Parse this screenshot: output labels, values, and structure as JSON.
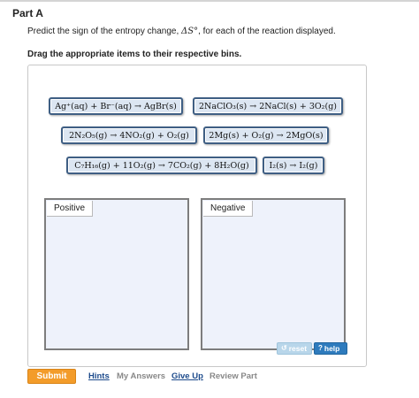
{
  "part_title": "Part A",
  "question": {
    "before": "Predict the sign of the entropy change, ",
    "symbol": "ΔS°",
    "after": ", for each of the reaction displayed."
  },
  "instruction": "Drag the appropriate items to their respective bins.",
  "items": [
    "Ag⁺(aq) + Br⁻(aq) → AgBr(s)",
    "2NaClO₃(s) → 2NaCl(s) + 3O₂(g)",
    "2N₂O₅(g) → 4NO₂(g) + O₂(g)",
    "2Mg(s) + O₂(g) → 2MgO(s)",
    "C₇H₁₆(g) + 11O₂(g) → 7CO₂(g) + 8H₂O(g)",
    "I₂(s) → I₂(g)"
  ],
  "bins": {
    "positive": "Positive",
    "negative": "Negative"
  },
  "controls": {
    "reset": "reset",
    "help": "help"
  },
  "footer": {
    "submit": "Submit",
    "hints": "Hints",
    "my_answers": "My Answers",
    "give_up": "Give Up",
    "review_part": "Review Part"
  }
}
